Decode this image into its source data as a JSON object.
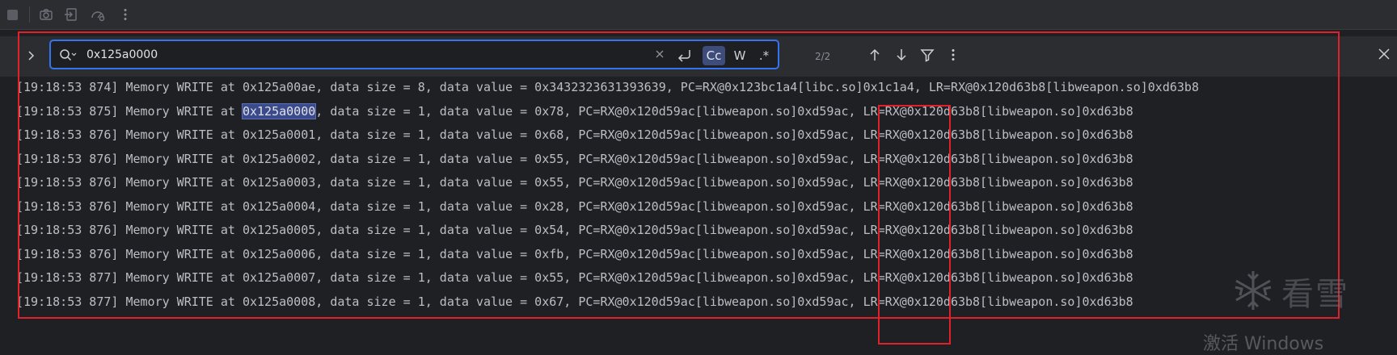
{
  "search": {
    "query": "0x125a0000",
    "match_case_label": "Cc",
    "whole_words_label": "W",
    "regex_label": ".*",
    "match_count": "2/2"
  },
  "log": {
    "lines": [
      {
        "pre": "[19:18:53 874] Memory WRITE at 0x125a00ae, data size = 8, data value = 0x3432323631393639, PC=RX@0x123bc1a4[libc.so]0x1c1a4, LR=RX@0x120d63b8[libweapon.so]0xd63b8",
        "hl": "",
        "post": ""
      },
      {
        "pre": "[19:18:53 875] Memory WRITE at ",
        "hl": "0x125a0000",
        "post": ", data size = 1, data value = 0x78, PC=RX@0x120d59ac[libweapon.so]0xd59ac, LR=RX@0x120d63b8[libweapon.so]0xd63b8"
      },
      {
        "pre": "[19:18:53 876] Memory WRITE at 0x125a0001, data size = 1, data value = 0x68, PC=RX@0x120d59ac[libweapon.so]0xd59ac, LR=RX@0x120d63b8[libweapon.so]0xd63b8",
        "hl": "",
        "post": ""
      },
      {
        "pre": "[19:18:53 876] Memory WRITE at 0x125a0002, data size = 1, data value = 0x55, PC=RX@0x120d59ac[libweapon.so]0xd59ac, LR=RX@0x120d63b8[libweapon.so]0xd63b8",
        "hl": "",
        "post": ""
      },
      {
        "pre": "[19:18:53 876] Memory WRITE at 0x125a0003, data size = 1, data value = 0x55, PC=RX@0x120d59ac[libweapon.so]0xd59ac, LR=RX@0x120d63b8[libweapon.so]0xd63b8",
        "hl": "",
        "post": ""
      },
      {
        "pre": "[19:18:53 876] Memory WRITE at 0x125a0004, data size = 1, data value = 0x28, PC=RX@0x120d59ac[libweapon.so]0xd59ac, LR=RX@0x120d63b8[libweapon.so]0xd63b8",
        "hl": "",
        "post": ""
      },
      {
        "pre": "[19:18:53 876] Memory WRITE at 0x125a0005, data size = 1, data value = 0x54, PC=RX@0x120d59ac[libweapon.so]0xd59ac, LR=RX@0x120d63b8[libweapon.so]0xd63b8",
        "hl": "",
        "post": ""
      },
      {
        "pre": "[19:18:53 876] Memory WRITE at 0x125a0006, data size = 1, data value = 0xfb, PC=RX@0x120d59ac[libweapon.so]0xd59ac, LR=RX@0x120d63b8[libweapon.so]0xd63b8",
        "hl": "",
        "post": ""
      },
      {
        "pre": "[19:18:53 877] Memory WRITE at 0x125a0007, data size = 1, data value = 0x55, PC=RX@0x120d59ac[libweapon.so]0xd59ac, LR=RX@0x120d63b8[libweapon.so]0xd63b8",
        "hl": "",
        "post": ""
      },
      {
        "pre": "[19:18:53 877] Memory WRITE at 0x125a0008, data size = 1, data value = 0x67, PC=RX@0x120d59ac[libweapon.so]0xd59ac, LR=RX@0x120d63b8[libweapon.so]0xd63b8",
        "hl": "",
        "post": ""
      }
    ]
  },
  "watermark": {
    "brand": "看雪",
    "activate": "激活 Windows"
  },
  "colors": {
    "accent": "#3574f0",
    "annotation": "#e0202a",
    "highlight": "#3b4a8a"
  }
}
